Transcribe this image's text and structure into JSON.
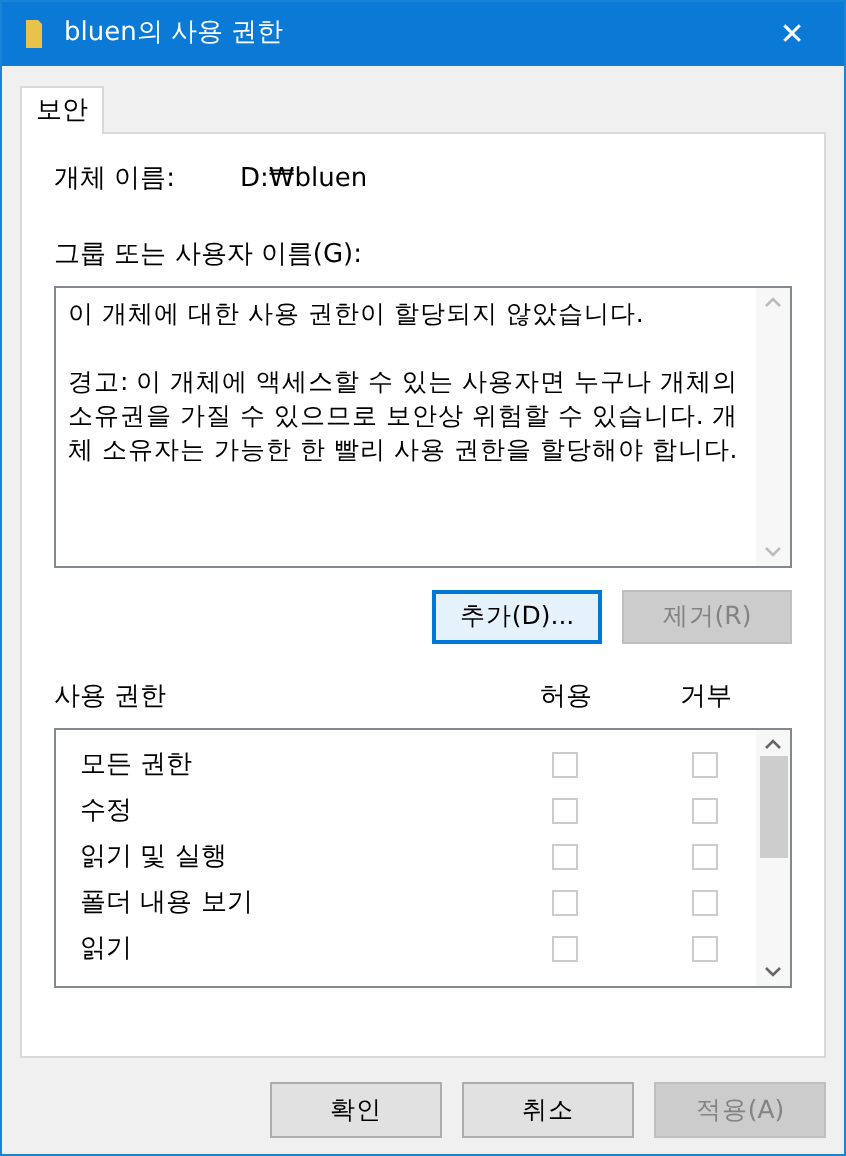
{
  "window": {
    "title": "bluen의 사용 권한",
    "close": "✕"
  },
  "tabs": [
    {
      "label": "보안",
      "selected": true
    }
  ],
  "object_name": {
    "label": "개체 이름:",
    "value": "D:₩bluen"
  },
  "group_section": {
    "label": "그룹 또는 사용자 이름(G):",
    "message": [
      "이 개체에 대한 사용 권한이 할당되지 않았습니다.",
      "경고: 이 개체에 액세스할 수 있는 사용자면 누구나 개체의 소유권을 가질 수 있으므로 보안상 위험할 수 있습니다. 개체 소유자는 가능한 한 빨리 사용 권한을 할당해야 합니다."
    ]
  },
  "group_buttons": [
    {
      "label": "추가(D)...",
      "disabled": false,
      "focused": true
    },
    {
      "label": "제거(R)",
      "disabled": true,
      "focused": false
    }
  ],
  "permissions": {
    "label": "사용 권한",
    "allow_header": "허용",
    "deny_header": "거부",
    "rows": [
      {
        "name": "모든 권한",
        "allow_checked": false,
        "deny_checked": false,
        "disabled": true
      },
      {
        "name": "수정",
        "allow_checked": false,
        "deny_checked": false,
        "disabled": true
      },
      {
        "name": "읽기 및 실행",
        "allow_checked": false,
        "deny_checked": false,
        "disabled": true
      },
      {
        "name": "폴더 내용 보기",
        "allow_checked": false,
        "deny_checked": false,
        "disabled": true
      },
      {
        "name": "읽기",
        "allow_checked": false,
        "deny_checked": false,
        "disabled": true
      }
    ]
  },
  "buttons": [
    {
      "label": "확인",
      "disabled": false
    },
    {
      "label": "취소",
      "disabled": false
    },
    {
      "label": "적용(A)",
      "disabled": true
    }
  ]
}
